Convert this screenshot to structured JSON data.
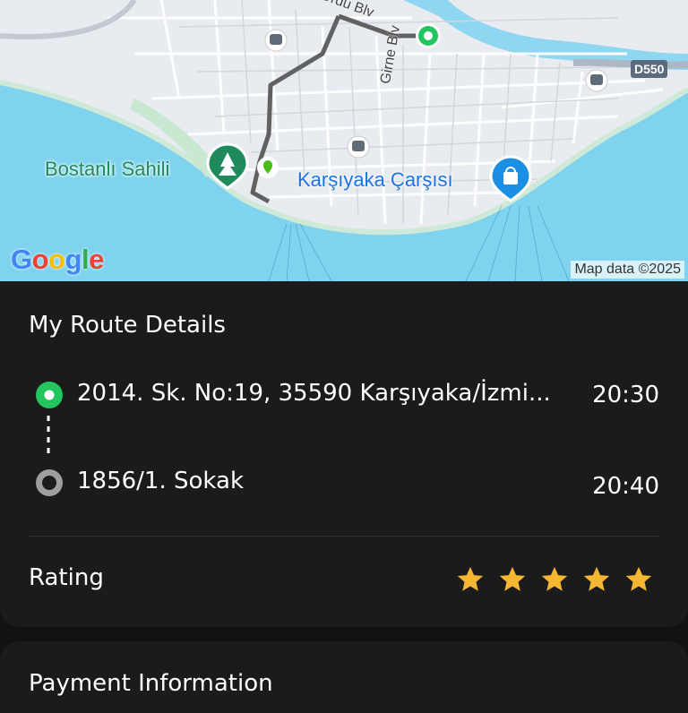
{
  "map": {
    "labels": {
      "ordu": "Ordu Blv",
      "girne": "Girne Blv",
      "bostanli": "Bostanlı Sahili",
      "karsiyaka": "Karşıyaka Çarşısı",
      "mapdata": "Map data ©2025",
      "d550": "D550"
    },
    "colors": {
      "water": "#7fd3ef",
      "land": "#e9ecef",
      "route": "#616161",
      "origin": "#22c55e"
    },
    "icons": [
      "train-station-icon",
      "park-pin-icon",
      "shopping-pin-icon",
      "location-pin-icon",
      "origin-marker-icon"
    ]
  },
  "route_details": {
    "title": "My Route Details",
    "stops": [
      {
        "address": "2014. Sk. No:19, 35590 Karşıyaka/İzmi...",
        "time": "20:30",
        "marker_color": "#22c55e"
      },
      {
        "address": "1856/1. Sokak",
        "time": "20:40",
        "marker_color": "#9e9e9e"
      }
    ]
  },
  "rating": {
    "label": "Rating",
    "value": 5,
    "max": 5,
    "star_color": "#f5b731"
  },
  "payment": {
    "title": "Payment Information"
  }
}
